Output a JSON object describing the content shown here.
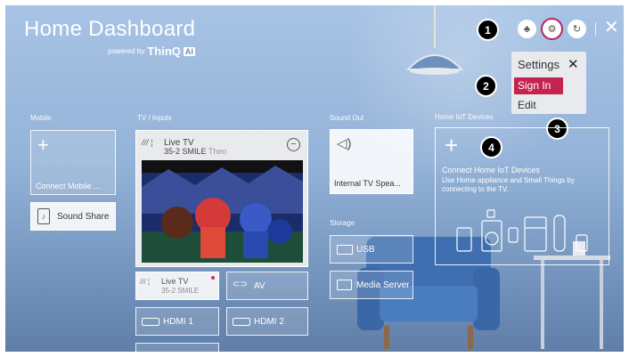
{
  "header": {
    "title": "Home Dashboard",
    "powered_by": "powered by",
    "brand": "ThinQ",
    "brand_badge": "AI"
  },
  "top_icons": [
    {
      "name": "profile-icon",
      "glyph": "♣"
    },
    {
      "name": "settings-gear-icon",
      "glyph": "⚙"
    },
    {
      "name": "refresh-icon",
      "glyph": "↻"
    }
  ],
  "close_glyph": "✕",
  "settings_menu": {
    "title": "Settings",
    "close": "✕",
    "items": [
      "Sign In",
      "Edit"
    ]
  },
  "callouts": [
    "1",
    "2",
    "3",
    "4"
  ],
  "sections": {
    "mobile": "Mobile",
    "tv_inputs": "TV / Inputs",
    "sound_out": "Sound Out",
    "storage": "Storage",
    "iot": "Home IoT Devices"
  },
  "mobile": {
    "connect_label": "Connect Mobile ...",
    "sound_share": "Sound Share",
    "plus": "+"
  },
  "tv": {
    "live_name": "Live TV",
    "channel": "35-2 SMILE",
    "program": "Theo",
    "minus": "−"
  },
  "inputs": {
    "live_tv": "Live TV",
    "live_channel": "35-2 SMILE",
    "av": "AV",
    "hdmi1": "HDMI 1",
    "hdmi2": "HDMI 2"
  },
  "sound_out": {
    "internal": "Internal TV Spea..."
  },
  "storage": {
    "usb": "USB",
    "media_server": "Media Server"
  },
  "iot": {
    "plus": "+",
    "title": "Connect Home IoT Devices",
    "desc": "Use Home appliance and Small Things by connecting to the TV."
  },
  "colors": {
    "accent": "#c4224f",
    "callout": "#000000"
  }
}
